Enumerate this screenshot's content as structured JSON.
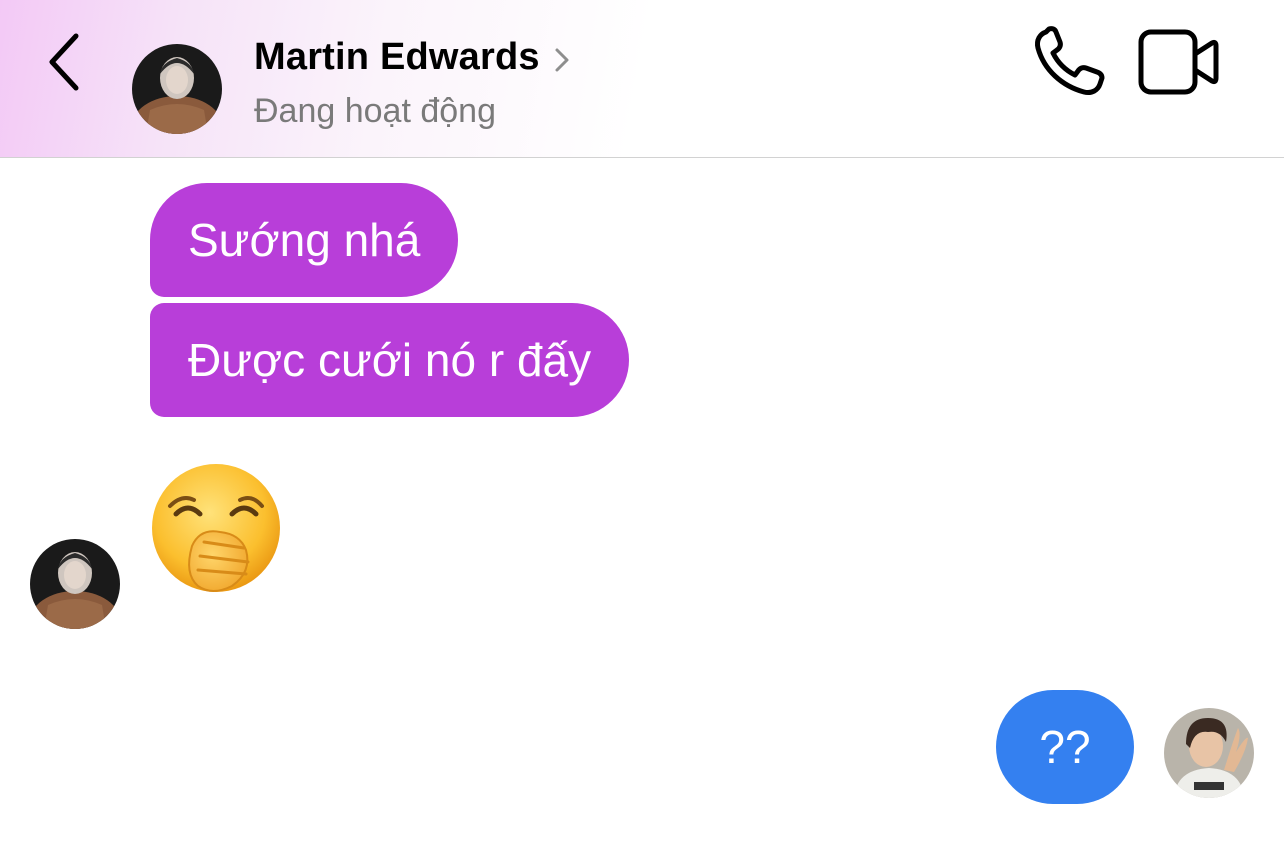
{
  "header": {
    "contact_name": "Martin Edwards",
    "status": "Đang hoạt động",
    "back_icon": "chevron-left-icon",
    "call_icon": "phone-icon",
    "video_icon": "video-camera-icon"
  },
  "messages": [
    {
      "from": "Martin Edwards",
      "text": "Sướng nhá"
    },
    {
      "from": "Martin Edwards",
      "text": "Được cưới nó r đấy"
    },
    {
      "from": "Martin Edwards",
      "emoji": "yawning-face"
    },
    {
      "from": "me",
      "text": "??"
    }
  ],
  "colors": {
    "incoming_bubble": "#b83ed9",
    "outgoing_bubble": "#3480f0",
    "status_text": "#7a7a7a"
  }
}
